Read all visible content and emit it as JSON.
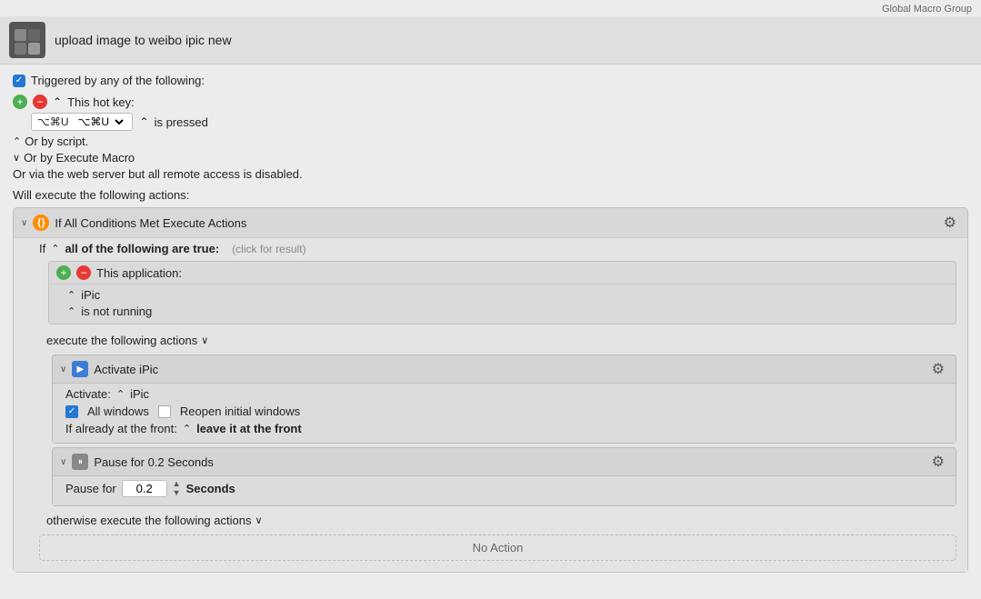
{
  "global_macro_label": "Global Macro Group",
  "macro": {
    "title": "upload image to weibo ipic new",
    "triggered_label": "Triggered by any of the following:",
    "hotkey_label": "This hot key:",
    "hotkey_value": "⌥⌘U",
    "is_pressed_label": "is pressed",
    "or_by_script": "Or by script.",
    "or_by_execute_macro": "Or by Execute Macro",
    "webserver_label": "Or via the web server but all remote access is disabled.",
    "will_execute_label": "Will execute the following actions:",
    "conditions_block": {
      "title": "If All Conditions Met Execute Actions",
      "if_label": "If",
      "all_label": "all of the following are true:",
      "click_result": "(click for result)",
      "app_label": "This application:",
      "app_name": "iPic",
      "app_status": "is not running",
      "execute_label": "execute the following actions"
    },
    "activate_block": {
      "title": "Activate iPic",
      "activate_label": "Activate:",
      "activate_value": "iPic",
      "all_windows_label": "All windows",
      "all_windows_checked": true,
      "reopen_windows_label": "Reopen initial windows",
      "reopen_windows_checked": false,
      "front_label": "If already at the front:",
      "front_value": "leave it at the front"
    },
    "pause_block": {
      "title": "Pause for 0.2 Seconds",
      "pause_label": "Pause for",
      "pause_value": "0.2",
      "unit_label": "Seconds"
    },
    "otherwise_label": "otherwise execute the following actions",
    "no_action_label": "No Action"
  }
}
